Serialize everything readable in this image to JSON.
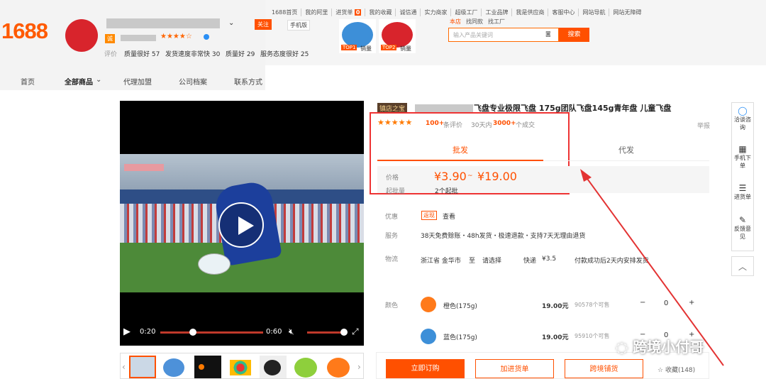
{
  "header": {
    "logo": "1688",
    "shop_badge": "诚",
    "follow": "关注",
    "mobile": "手机版",
    "rating_label": "评价",
    "ratings": [
      "质量很好 57",
      "发货速度非常快 30",
      "质量好 29",
      "服务态度很好 25"
    ],
    "stars": "★★★★☆"
  },
  "topnav": [
    "1688首页",
    "我的阿里",
    "进货单",
    "我的收藏",
    "诚信通",
    "实力商家",
    "超级工厂",
    "工业品牌",
    "我是供应商",
    "客服中心",
    "网站导航",
    "网站无障碍"
  ],
  "cart_count": "0",
  "promos": [
    {
      "label": "TOP1",
      "tag": "销量"
    },
    {
      "label": "TOP2",
      "tag": "销量"
    }
  ],
  "search": {
    "placeholder": "输入产品关键词",
    "button": "搜索",
    "tabs": [
      "本店",
      "找同款",
      "找工厂"
    ]
  },
  "shopnav": [
    "首页",
    "全部商品",
    "代理加盟",
    "公司档案",
    "联系方式"
  ],
  "product": {
    "badge": "镇店之宝",
    "title": "飞盘专业极限飞盘 175g团队飞盘145g青年盘 儿童飞盘",
    "stars": "★★★★★",
    "reviews_num": "100+",
    "reviews_label": "条评价",
    "sales_prefix": "30天内",
    "sales_num": "3000+",
    "sales_suffix": "个成交",
    "report": "举报"
  },
  "tabs": {
    "active": "批发",
    "other": "代发"
  },
  "price": {
    "label": "价格",
    "min": "¥3.90",
    "sep": "~",
    "max": "¥19.00",
    "moq_label": "起批量",
    "moq": "2个起批"
  },
  "offers": {
    "label": "优惠",
    "tag": "返现",
    "view": "查看"
  },
  "service": {
    "label": "服务",
    "text": "38天免费赊账・48h发货・极速退款・支持7天无理由退货"
  },
  "shipping": {
    "label": "物流",
    "from": "浙江省 金华市",
    "to": "至",
    "select": "请选择",
    "express": "快递",
    "fee": "¥3.5",
    "note": "付款成功后2天内安排发货"
  },
  "colors": {
    "label": "颜色",
    "items": [
      {
        "name": "橙色(175g)",
        "price": "19.00元",
        "stock": "90578个可售",
        "qty": "0"
      },
      {
        "name": "蓝色(175g)",
        "price": "19.00元",
        "stock": "95910个可售",
        "qty": "0"
      }
    ]
  },
  "video": {
    "current": "0:20",
    "total": "0:60"
  },
  "actions": {
    "order": "立即订购",
    "cart": "加进货单",
    "cross": "跨境铺货",
    "fav": "收藏(148)"
  },
  "sidebar": [
    {
      "label": "洽谈咨询"
    },
    {
      "label": "手机下单"
    },
    {
      "label": "进货单"
    },
    {
      "label": "反馈意见"
    }
  ],
  "watermark": "跨境小付哥",
  "colors_theme": {
    "accent": "#ff5000",
    "highlight": "#e33333"
  }
}
